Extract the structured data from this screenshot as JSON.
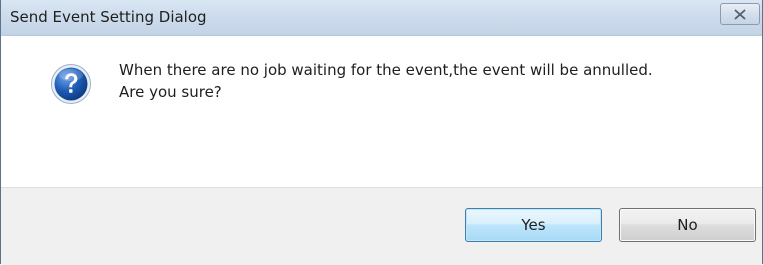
{
  "window": {
    "title": "Send Event Setting Dialog"
  },
  "titlebar": {
    "close_icon": "close-x-icon"
  },
  "dialog": {
    "icon": "question-mark-icon",
    "message_line1": "When there are no job waiting for the event,the event will be annulled.",
    "message_line2": "Are you sure?"
  },
  "buttons": {
    "yes_label": "Yes",
    "no_label": "No"
  },
  "colors": {
    "question_icon": "#1d5bb5",
    "default_button_border": "#3c7fb1"
  }
}
